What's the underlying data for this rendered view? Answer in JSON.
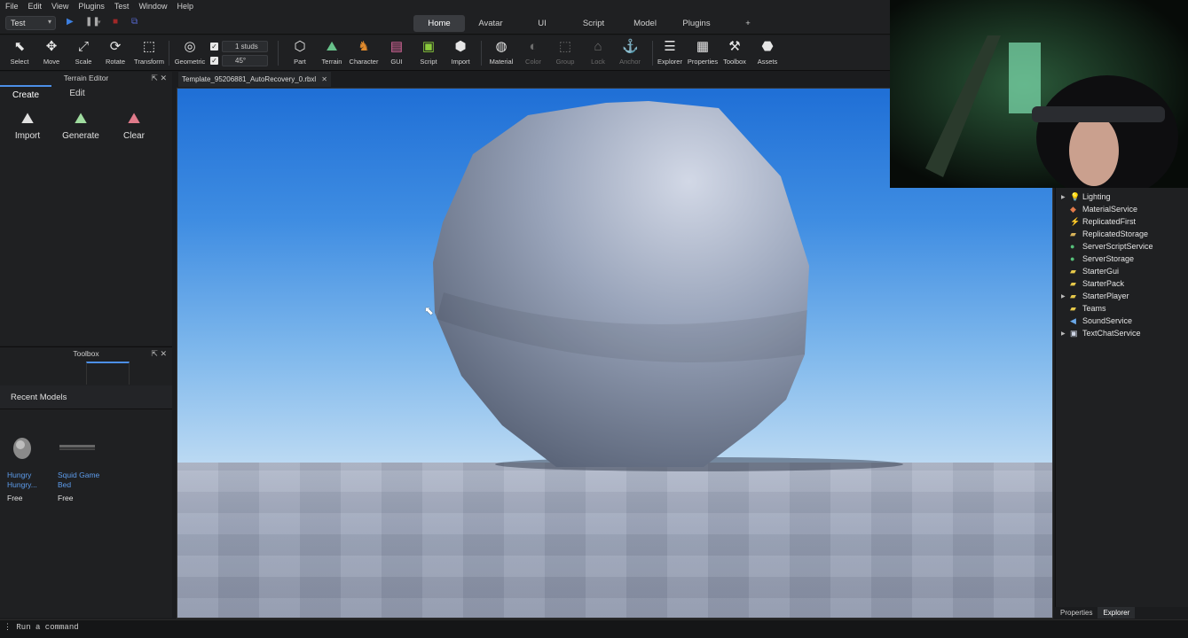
{
  "menubar": [
    "File",
    "Edit",
    "View",
    "Plugins",
    "Test",
    "Window",
    "Help"
  ],
  "test_select": "Test",
  "ribbon_tabs": [
    "Home",
    "Avatar",
    "UI",
    "Script",
    "Model",
    "Plugins",
    "+"
  ],
  "toolbar": {
    "select": "Select",
    "move": "Move",
    "scale": "Scale",
    "rotate": "Rotate",
    "transform": "Transform",
    "geometric": "Geometric",
    "move_snap": "1 studs",
    "rotate_snap": "45°",
    "part": "Part",
    "terrain": "Terrain",
    "character": "Character",
    "gui": "GUI",
    "script": "Script",
    "import": "Import",
    "material": "Material",
    "color": "Color",
    "group": "Group",
    "lock": "Lock",
    "anchor": "Anchor",
    "explorer": "Explorer",
    "properties": "Properties",
    "toolbox": "Toolbox",
    "assets": "Assets"
  },
  "terrain_editor": {
    "title": "Terrain Editor",
    "tabs": [
      "Create",
      "Edit"
    ],
    "buttons": [
      "Import",
      "Generate",
      "Clear"
    ]
  },
  "toolbox": {
    "title": "Toolbox",
    "section": "Recent Models",
    "models": [
      {
        "name": "Hungry Hungry...",
        "price": "Free"
      },
      {
        "name": "Squid Game Bed",
        "price": "Free"
      }
    ]
  },
  "document_tab": "Template_95206881_AutoRecovery_0.rbxl",
  "explorer_items": [
    "Lighting",
    "MaterialService",
    "ReplicatedFirst",
    "ReplicatedStorage",
    "ServerScriptService",
    "ServerStorage",
    "StarterGui",
    "StarterPack",
    "StarterPlayer",
    "Teams",
    "SoundService",
    "TextChatService"
  ],
  "bottom_tabs": [
    "Properties",
    "Explorer"
  ],
  "command_bar": "Run a command",
  "colors": {
    "accent": "#4c8fe8",
    "link": "#5d9cec",
    "panel": "#1f2022",
    "sky": "#3f8de2"
  }
}
